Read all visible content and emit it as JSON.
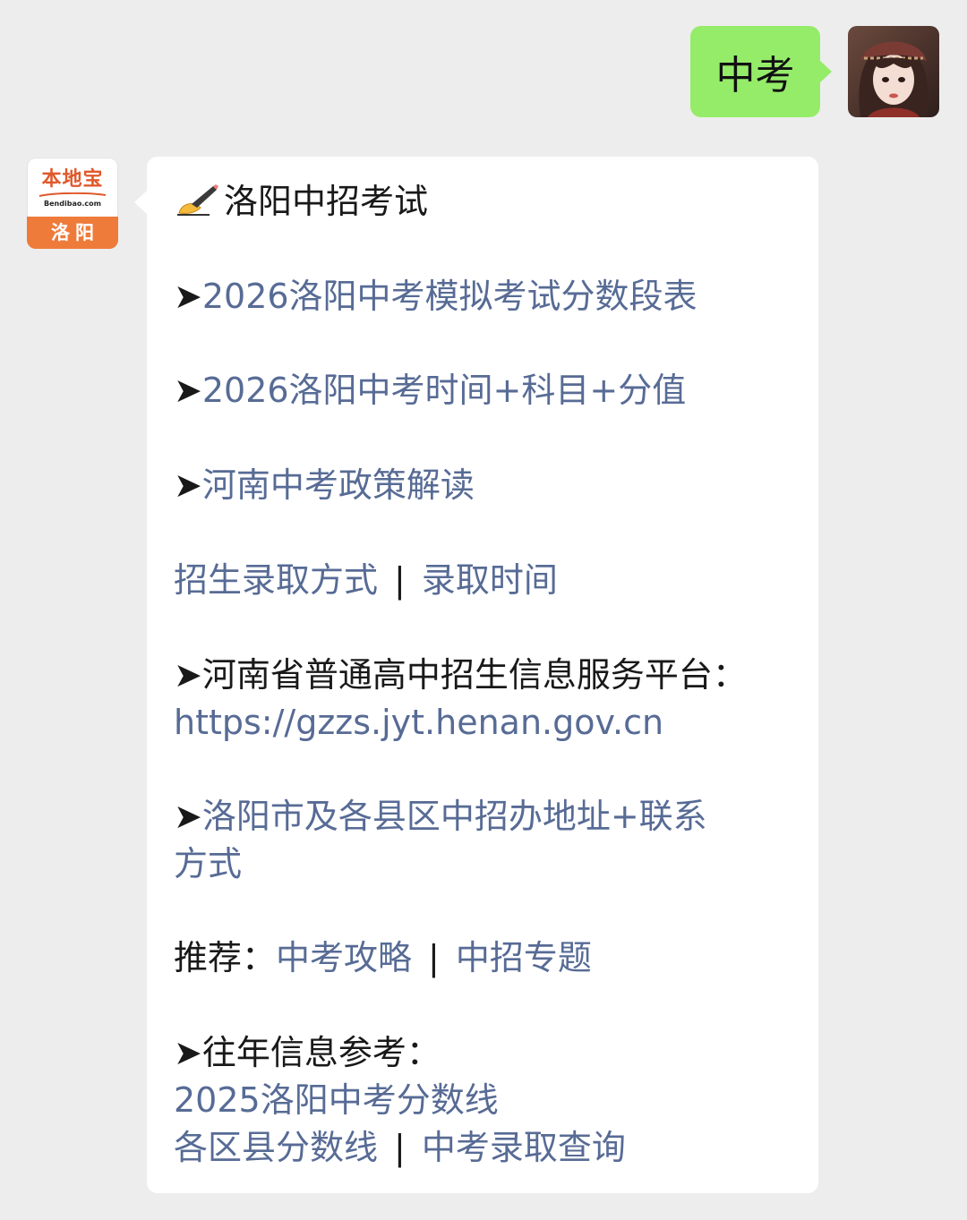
{
  "user_message": {
    "text": "中考"
  },
  "bot_avatar": {
    "brand": "本地宝",
    "domain": "Bendibao.com",
    "city": "洛阳"
  },
  "reply": {
    "title": "洛阳中招考试",
    "title_icon": "writing-hand-icon",
    "arrow": "➤",
    "link_score_table": "2026洛阳中考模拟考试分数段表",
    "link_exam_time": "2026洛阳中考时间+科目+分值",
    "link_policy": "河南中考政策解读",
    "link_admission_method": "招生录取方式",
    "separator": "|",
    "link_admission_time": "录取时间",
    "platform_label": "河南省普通高中招生信息服务平台：",
    "platform_url": "https://gzzs.jyt.henan.gov.cn",
    "link_office_line1": "洛阳市及各县区中招办地址+联系",
    "link_office_line2": "方式",
    "recommend_label": "推荐：",
    "link_strategy": "中考攻略",
    "link_topic": "中招专题",
    "history_label": "往年信息参考：",
    "link_2025_score": "2025洛阳中考分数线",
    "link_district_score": "各区县分数线",
    "link_admission_query": "中考录取查询"
  },
  "colors": {
    "background": "#ededed",
    "user_bubble": "#95ec69",
    "bot_bubble": "#ffffff",
    "link": "#576b95",
    "brand_orange": "#ef7b3a"
  }
}
